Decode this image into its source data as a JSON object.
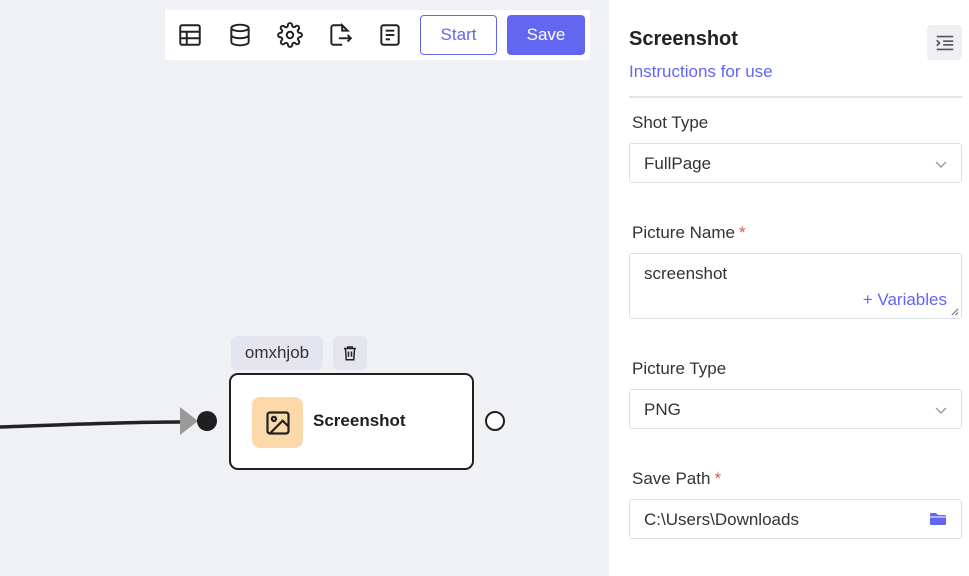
{
  "toolbar": {
    "icons": [
      "table-icon",
      "database-icon",
      "settings-icon",
      "export-file-icon",
      "document-icon"
    ],
    "start_label": "Start",
    "save_label": "Save"
  },
  "node": {
    "id_label": "omxhjob",
    "title": "Screenshot",
    "icon": "image-icon",
    "icon_bg": "#fcd9ab"
  },
  "panel": {
    "title": "Screenshot",
    "help_link": "Instructions for use",
    "fields": {
      "shot_type": {
        "label": "Shot Type",
        "value": "FullPage"
      },
      "picture_name": {
        "label": "Picture Name",
        "required_mark": "*",
        "value": "screenshot",
        "variables_label": "+ Variables"
      },
      "picture_type": {
        "label": "Picture Type",
        "value": "PNG"
      },
      "save_path": {
        "label": "Save Path",
        "required_mark": "*",
        "value": "C:\\Users\\Downloads"
      }
    }
  },
  "colors": {
    "accent": "#6366f1",
    "canvas_bg": "#f0f1f5",
    "required": "#e0574b"
  }
}
